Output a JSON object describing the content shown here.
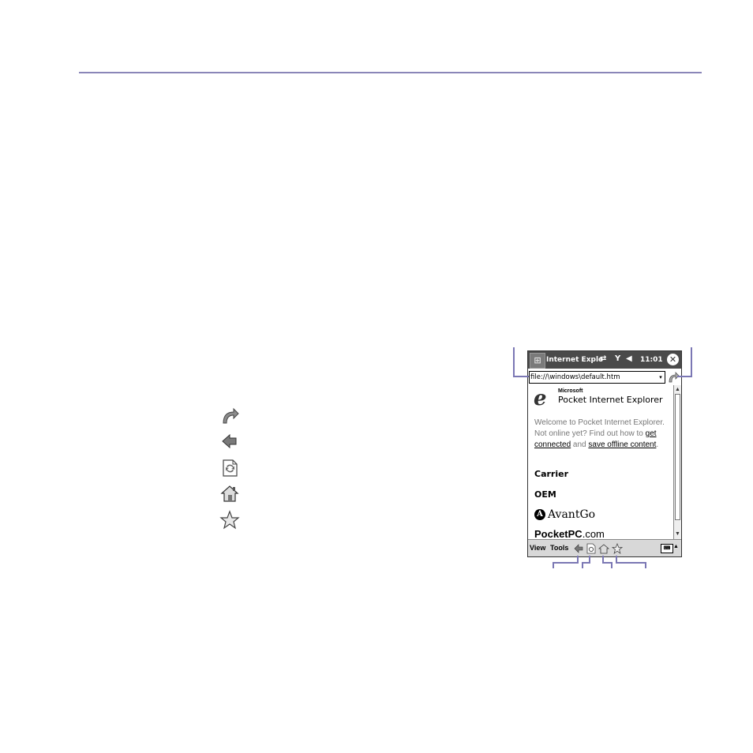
{
  "screen": {
    "titlebar": {
      "start_glyph": "⊞",
      "app_title": "Internet Explo",
      "sync_glyph": "⇄",
      "signal_glyph": "Y",
      "volume_glyph": "◀",
      "clock": "11:01",
      "close_glyph": "✕"
    },
    "address": {
      "url": "file://\\windows\\default.htm",
      "dropdown_glyph": "▾"
    },
    "page": {
      "ie_logo_letter": "e",
      "brand_small": "Microsoft",
      "brand_big": "Pocket Internet Explorer",
      "welcome_text_1": "Welcome to Pocket Internet Explorer. Not online yet? Find out how to ",
      "link_get_connected": "get connected",
      "welcome_text_2": " and ",
      "link_save_offline": "save offline content",
      "welcome_text_3": ".",
      "sponsor_carrier": "Carrier",
      "sponsor_oem": "OEM",
      "avantgo_badge": "A",
      "avantgo": "AvantGo",
      "pocketpc_bold": "PocketPC",
      "pocketpc_suffix": ".com"
    },
    "scroll": {
      "up_glyph": "▲",
      "down_glyph": "▼"
    },
    "menubar": {
      "view": "View",
      "tools": "Tools",
      "keyboard_glyph": "⌨",
      "sip_up_glyph": "▲"
    }
  },
  "icons": {
    "legend": [
      "go-icon",
      "back-icon",
      "refresh-icon",
      "home-icon",
      "favorites-icon"
    ]
  },
  "colors": {
    "rule": "#8a86b8",
    "callout": "#7b77b4",
    "titlebar": "#4a4a4a"
  }
}
